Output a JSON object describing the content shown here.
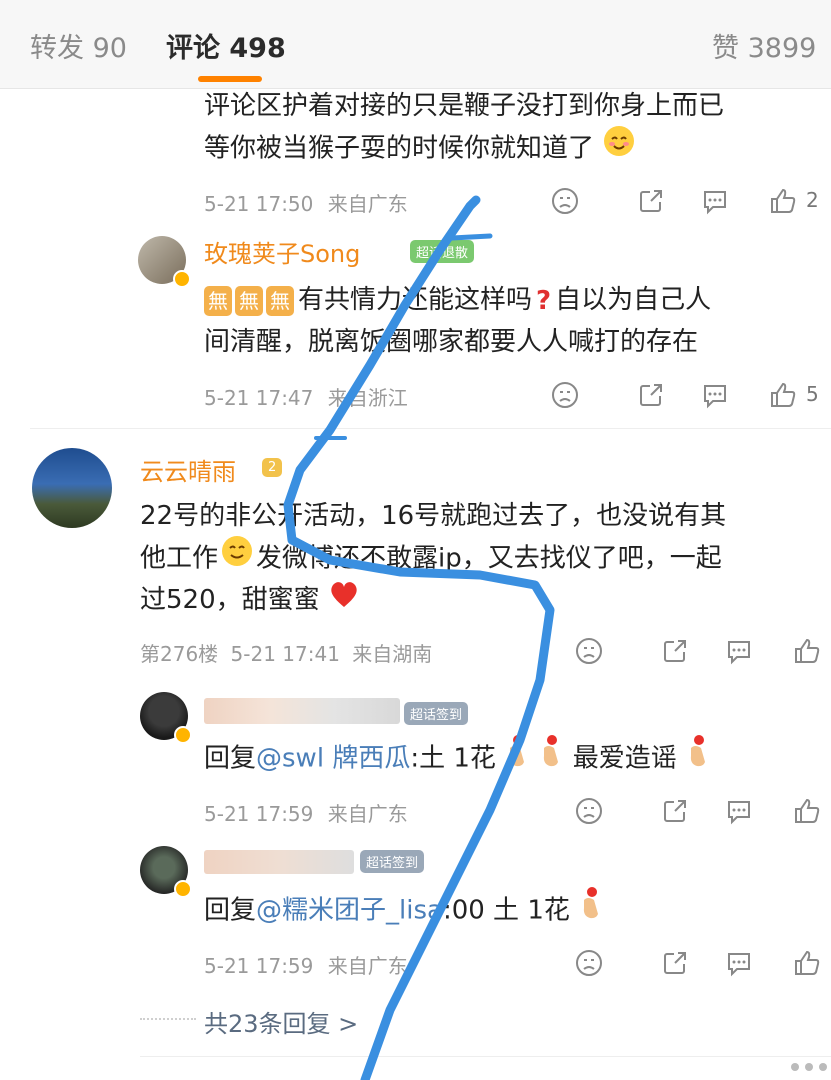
{
  "tabs": [
    {
      "label": "转发 90"
    },
    {
      "label": "评论 498"
    },
    {
      "label": "赞 3899"
    }
  ],
  "comments": [
    {
      "text_lines": [
        "评论区护着对接的只是鞭子没打到你身上而已",
        "等你被当猴子耍的时候你就知道了"
      ],
      "emoji": "blush",
      "time": "5-21 17:50",
      "location": "来自广东",
      "like_count": "2"
    },
    {
      "name": "玫瑰荚子Song",
      "badge": "超话退散",
      "text_lines": [
        "有共情力还能这样吗",
        "自以为自己人",
        "间清醒，脱离饭圈哪家都要人人喊打的存在"
      ],
      "prefix_badges": [
        "無",
        "無",
        "無"
      ],
      "time": "5-21 17:47",
      "location": "来自浙江",
      "like_count": "5"
    },
    {
      "name": "云云晴雨",
      "badge": "2",
      "text_lines": [
        "22号的非公开活动，16号就跑过去了，也没说有其",
        "他工作",
        "发微博还不敢露ip，又去找仪了吧，一起",
        "过520，甜蜜蜜"
      ],
      "floor": "第276楼",
      "time": "5-21 17:41",
      "location": "来自湖南"
    }
  ],
  "replies": [
    {
      "badge": "超话签到",
      "text_prefix": "回复",
      "mention": "@swl 牌西瓜",
      "text_suffix": ":土 1花",
      "text_end": "最爱造谣",
      "time": "5-21 17:59",
      "location": "来自广东"
    },
    {
      "badge": "超话签到",
      "text_prefix": "回复",
      "mention": "@糯米团子_lisa",
      "text_suffix": ":00 土 1花",
      "time": "5-21 17:59",
      "location": "来自广东"
    }
  ],
  "more_replies": "共23条回复 >",
  "colors": {
    "accent": "#ff8200",
    "annotation": "#3a8fe0",
    "mention": "#4a7eb8"
  }
}
